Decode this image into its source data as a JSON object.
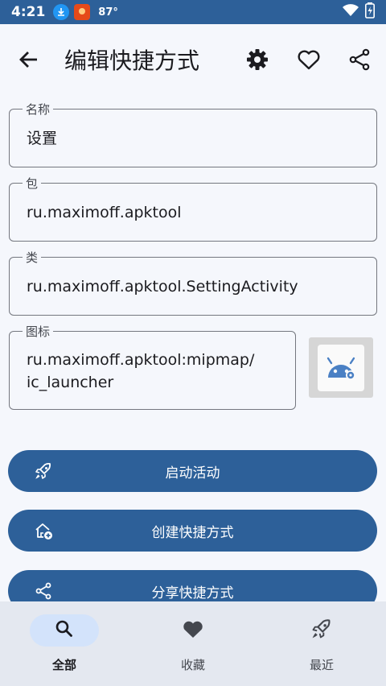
{
  "status": {
    "time": "4:21",
    "temperature": "87°"
  },
  "appbar": {
    "title": "编辑快捷方式",
    "icons": [
      "back-arrow-icon",
      "gear-icon",
      "heart-outline-icon",
      "share-icon"
    ]
  },
  "fields": {
    "name": {
      "label": "名称",
      "value": "设置"
    },
    "package": {
      "label": "包",
      "value": "ru.maximoff.apktool"
    },
    "class": {
      "label": "类",
      "value": "ru.maximoff.apktool.SettingActivity"
    },
    "icon": {
      "label": "图标",
      "value_line1": "ru.maximoff.apktool:mipmap/",
      "value_line2": "ic_launcher"
    }
  },
  "buttons": {
    "launch": "启动活动",
    "create": "创建快捷方式",
    "share": "分享快捷方式"
  },
  "nav": {
    "items": [
      {
        "label": "全部",
        "icon": "search-icon",
        "active": true
      },
      {
        "label": "收藏",
        "icon": "heart-icon",
        "active": false
      },
      {
        "label": "最近",
        "icon": "rocket-icon",
        "active": false
      }
    ]
  },
  "colors": {
    "primary": "#2d6099",
    "background": "#f5f7fc",
    "nav": "#e4e8f0",
    "active_pill": "#d3e3fb"
  }
}
